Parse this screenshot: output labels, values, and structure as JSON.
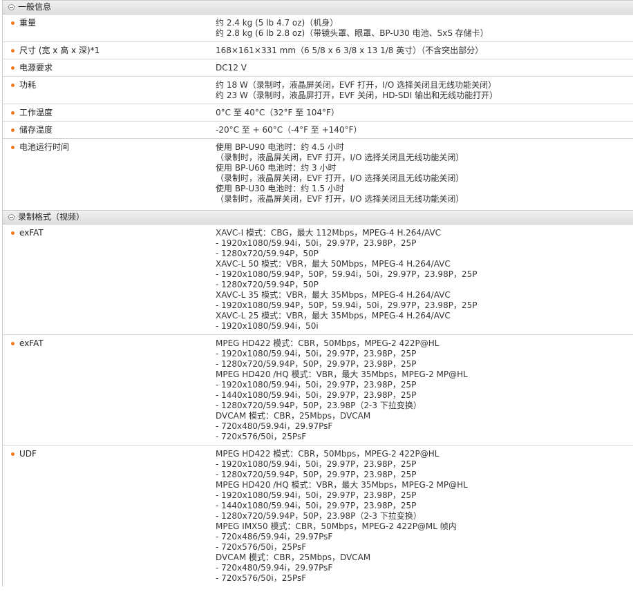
{
  "sections": [
    {
      "title": "一般信息",
      "rows": [
        {
          "label": "重量",
          "lines": [
            "约 2.4 kg (5 lb 4.7 oz)（机身）",
            "约 2.8 kg (6 lb 2.8 oz)（带镜头罩、眼罩、BP-U30 电池、SxS 存储卡）"
          ]
        },
        {
          "label": "尺寸 (宽 x 高 x 深)*1",
          "lines": [
            "168×161×331 mm（6 5/8 x 6 3/8 x 13 1/8 英寸）（不含突出部分）"
          ]
        },
        {
          "label": "电源要求",
          "lines": [
            "DC12 V"
          ]
        },
        {
          "label": "功耗",
          "lines": [
            "约 18 W（录制时，液晶屏关闭，EVF 打开，I/O 选择关闭且无线功能关闭）",
            "约 23 W（录制时，液晶屏打开，EVF 关闭，HD-SDI 输出和无线功能打开）"
          ]
        },
        {
          "label": "工作温度",
          "lines": [
            "0°C 至 40°C（32°F 至 104°F）"
          ]
        },
        {
          "label": "储存温度",
          "lines": [
            "-20°C 至 + 60°C（-4°F 至 +140°F）"
          ]
        },
        {
          "label": "电池运行时间",
          "lines": [
            "使用 BP-U90 电池时：约 4.5 小时",
            "（录制时，液晶屏关闭，EVF 打开，I/O 选择关闭且无线功能关闭）",
            "使用 BP-U60 电池时：约 3 小时",
            "（录制时，液晶屏关闭，EVF 打开，I/O 选择关闭且无线功能关闭）",
            "使用 BP-U30 电池时：约 1.5 小时",
            "（录制时，液晶屏关闭，EVF 打开，I/O 选择关闭且无线功能关闭）"
          ]
        }
      ]
    },
    {
      "title": "录制格式（视频）",
      "rows": [
        {
          "label": "exFAT",
          "lines": [
            "XAVC-I 模式：CBG，最大 112Mbps，MPEG-4 H.264/AVC",
            "- 1920x1080/59.94i，50i，29.97P，23.98P，25P",
            "- 1280x720/59.94P，50P",
            "XAVC-L 50 模式：VBR，最大 50Mbps，MPEG-4 H.264/AVC",
            "- 1920x1080/59.94P，50P，59.94i，50i，29.97P，23.98P，25P",
            "- 1280x720/59.94P，50P",
            "XAVC-L 35 模式：VBR，最大 35Mbps，MPEG-4 H.264/AVC",
            "- 1920x1080/59.94P，50P，59.94i，50i，29.97P，23.98P，25P",
            "XAVC-L 25 模式：VBR，最大 35Mbps，MPEG-4 H.264/AVC",
            "- 1920x1080/59.94i，50i"
          ]
        },
        {
          "label": "exFAT",
          "lines": [
            "MPEG HD422 模式：CBR，50Mbps，MPEG-2 422P@HL",
            "- 1920x1080/59.94i，50i，29.97P，23.98P，25P",
            "- 1280x720/59.94P，50P，29.97P，23.98P，25P",
            "MPEG HD420 /HQ 模式：VBR，最大 35Mbps，MPEG-2 MP@HL",
            "- 1920x1080/59.94i，50i，29.97P，23.98P，25P",
            "- 1440x1080/59.94i，50i，29.97P，23.98P，25P",
            "- 1280x720/59.94P，50P，23.98P（2-3 下拉变换）",
            "DVCAM 模式：CBR，25Mbps，DVCAM",
            "- 720x480/59.94i，29.97PsF",
            "- 720x576/50i，25PsF"
          ]
        },
        {
          "label": "UDF",
          "lines": [
            "MPEG HD422 模式：CBR，50Mbps，MPEG-2 422P@HL",
            "- 1920x1080/59.94i，50i，29.97P，23.98P，25P",
            "- 1280x720/59.94P，50P，29.97P，23.98P，25P",
            "MPEG HD420 /HQ 模式：VBR，最大 35Mbps，MPEG-2 MP@HL",
            "- 1920x1080/59.94i，50i，29.97P，23.98P，25P",
            "- 1440x1080/59.94i，50i，29.97P，23.98P，25P",
            "- 1280x720/59.94P，50P，23.98P（2-3 下拉变换）",
            "MPEG IMX50 模式：CBR，50Mbps，MPEG-2 422P@ML 帧内",
            "- 720x486/59.94i，29.97PsF",
            "- 720x576/50i，25PsF",
            "DVCAM 模式：CBR，25Mbps，DVCAM",
            "- 720x480/59.94i，29.97PsF",
            "- 720x576/50i，25PsF"
          ]
        }
      ]
    }
  ]
}
